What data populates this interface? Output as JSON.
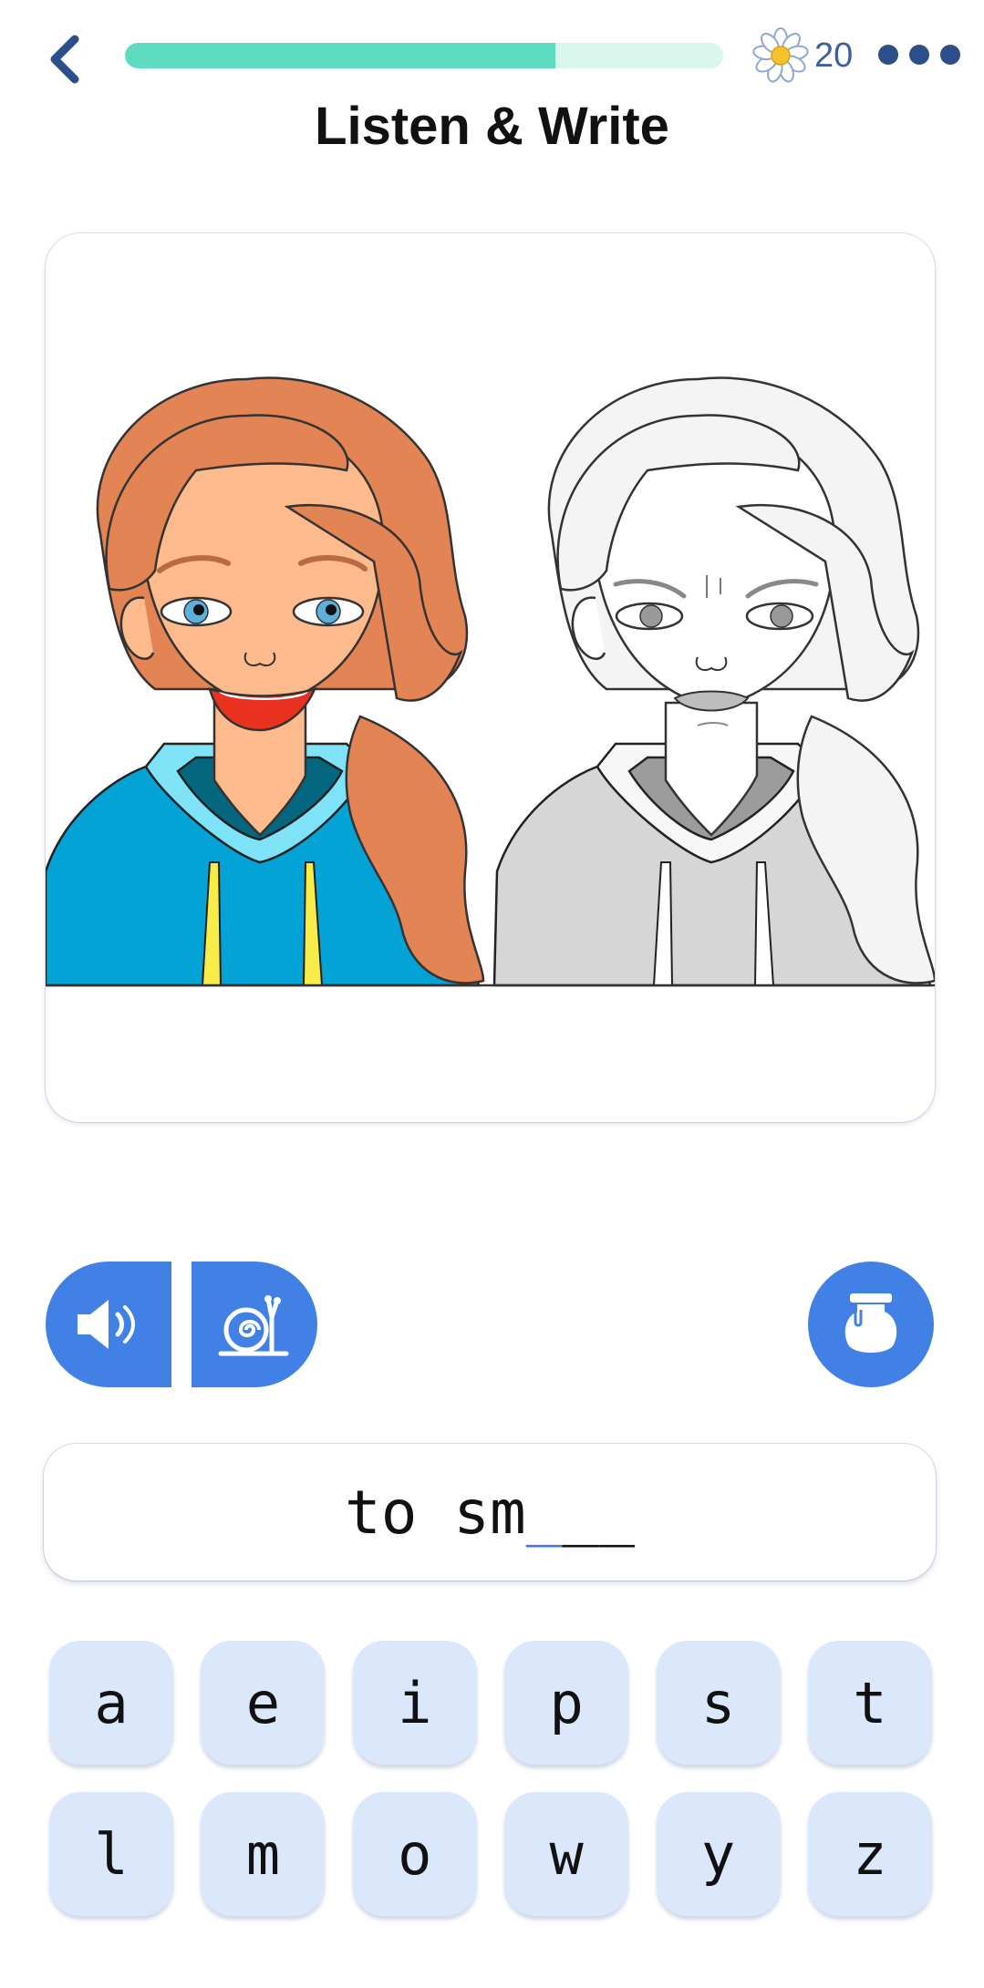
{
  "header": {
    "progress_fraction": 0.72,
    "progress_fill_color": "#5ddcbf",
    "progress_track_color": "#d8f6ec",
    "points_icon": "daisy-flower-icon",
    "points_value": "20",
    "back_icon": "chevron-left-icon",
    "more_icon": "more-dots-icon"
  },
  "title": "Listen & Write",
  "card": {
    "image": "happy-girl-colored-and-angry-girl-grayscale-illustration"
  },
  "audio": {
    "sound_icon": "speaker-icon",
    "slow_icon": "snail-icon",
    "hint_icon": "honey-pot-icon",
    "accent_color": "#4181e6"
  },
  "answer": {
    "typed": "to sm",
    "blanks": [
      "_",
      "_",
      "_"
    ],
    "active_blank_color": "#3f7ae0"
  },
  "keyboard": {
    "rows": [
      [
        "a",
        "e",
        "i",
        "p",
        "s",
        "t"
      ],
      [
        "l",
        "m",
        "o",
        "w",
        "y",
        "z"
      ]
    ]
  }
}
